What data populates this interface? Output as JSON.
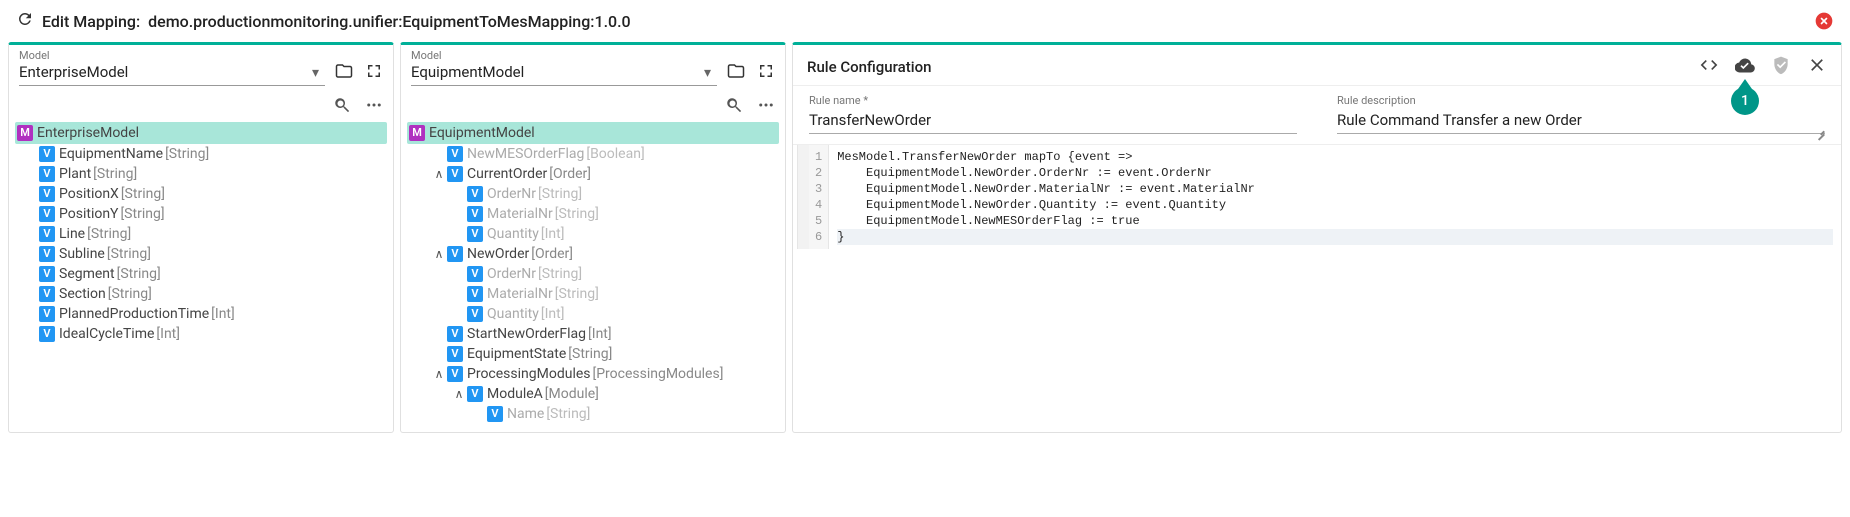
{
  "header": {
    "title_prefix": "Edit Mapping:",
    "mapping_path": "demo.productionmonitoring.unifier:EquipmentToMesMapping:1.0.0"
  },
  "left_panel": {
    "model_label": "Model",
    "model_name": "EnterpriseModel",
    "root": {
      "badge": "M",
      "name": "EnterpriseModel",
      "type": ""
    },
    "nodes": [
      {
        "badge": "V",
        "name": "EquipmentName",
        "type": "[String]",
        "dim": false,
        "indent": 1
      },
      {
        "badge": "V",
        "name": "Plant",
        "type": "[String]",
        "dim": false,
        "indent": 1
      },
      {
        "badge": "V",
        "name": "PositionX",
        "type": "[String]",
        "dim": false,
        "indent": 1
      },
      {
        "badge": "V",
        "name": "PositionY",
        "type": "[String]",
        "dim": false,
        "indent": 1
      },
      {
        "badge": "V",
        "name": "Line",
        "type": "[String]",
        "dim": false,
        "indent": 1
      },
      {
        "badge": "V",
        "name": "Subline",
        "type": "[String]",
        "dim": false,
        "indent": 1
      },
      {
        "badge": "V",
        "name": "Segment",
        "type": "[String]",
        "dim": false,
        "indent": 1
      },
      {
        "badge": "V",
        "name": "Section",
        "type": "[String]",
        "dim": false,
        "indent": 1
      },
      {
        "badge": "V",
        "name": "PlannedProductionTime",
        "type": "[Int]",
        "dim": false,
        "indent": 1
      },
      {
        "badge": "V",
        "name": "IdealCycleTime",
        "type": "[Int]",
        "dim": false,
        "indent": 1
      }
    ]
  },
  "mid_panel": {
    "model_label": "Model",
    "model_name": "EquipmentModel",
    "root": {
      "badge": "M",
      "name": "EquipmentModel",
      "type": ""
    },
    "nodes": [
      {
        "badge": "V",
        "name": "NewMESOrderFlag",
        "type": "[Boolean]",
        "dim": true,
        "indent": 1,
        "toggle": ""
      },
      {
        "badge": "V",
        "name": "CurrentOrder",
        "type": "[Order]",
        "dim": false,
        "indent": 1,
        "toggle": "∧"
      },
      {
        "badge": "V",
        "name": "OrderNr",
        "type": "[String]",
        "dim": true,
        "indent": 2,
        "toggle": ""
      },
      {
        "badge": "V",
        "name": "MaterialNr",
        "type": "[String]",
        "dim": true,
        "indent": 2,
        "toggle": ""
      },
      {
        "badge": "V",
        "name": "Quantity",
        "type": "[Int]",
        "dim": true,
        "indent": 2,
        "toggle": ""
      },
      {
        "badge": "V",
        "name": "NewOrder",
        "type": "[Order]",
        "dim": false,
        "indent": 1,
        "toggle": "∧"
      },
      {
        "badge": "V",
        "name": "OrderNr",
        "type": "[String]",
        "dim": true,
        "indent": 2,
        "toggle": ""
      },
      {
        "badge": "V",
        "name": "MaterialNr",
        "type": "[String]",
        "dim": true,
        "indent": 2,
        "toggle": ""
      },
      {
        "badge": "V",
        "name": "Quantity",
        "type": "[Int]",
        "dim": true,
        "indent": 2,
        "toggle": ""
      },
      {
        "badge": "V",
        "name": "StartNewOrderFlag",
        "type": "[Int]",
        "dim": false,
        "indent": 1,
        "toggle": ""
      },
      {
        "badge": "V",
        "name": "EquipmentState",
        "type": "[String]",
        "dim": false,
        "indent": 1,
        "toggle": ""
      },
      {
        "badge": "V",
        "name": "ProcessingModules",
        "type": "[ProcessingModules]",
        "dim": false,
        "indent": 1,
        "toggle": "∧"
      },
      {
        "badge": "V",
        "name": "ModuleA",
        "type": "[Module]",
        "dim": false,
        "indent": 2,
        "toggle": "∧"
      },
      {
        "badge": "V",
        "name": "Name",
        "type": "[String]",
        "dim": true,
        "indent": 3,
        "toggle": ""
      }
    ]
  },
  "rule_config": {
    "title": "Rule Configuration",
    "name_label": "Rule name *",
    "name_value": "TransferNewOrder",
    "desc_label": "Rule description",
    "desc_value": "Rule Command Transfer a new Order",
    "balloon": "1",
    "code_lines": [
      "MesModel.TransferNewOrder mapTo {event =>",
      "    EquipmentModel.NewOrder.OrderNr := event.OrderNr",
      "    EquipmentModel.NewOrder.MaterialNr := event.MaterialNr",
      "    EquipmentModel.NewOrder.Quantity := event.Quantity",
      "    EquipmentModel.NewMESOrderFlag := true",
      "}"
    ],
    "line_numbers": [
      "1",
      "2",
      "3",
      "4",
      "5",
      "6"
    ],
    "highlight_line": 6
  }
}
